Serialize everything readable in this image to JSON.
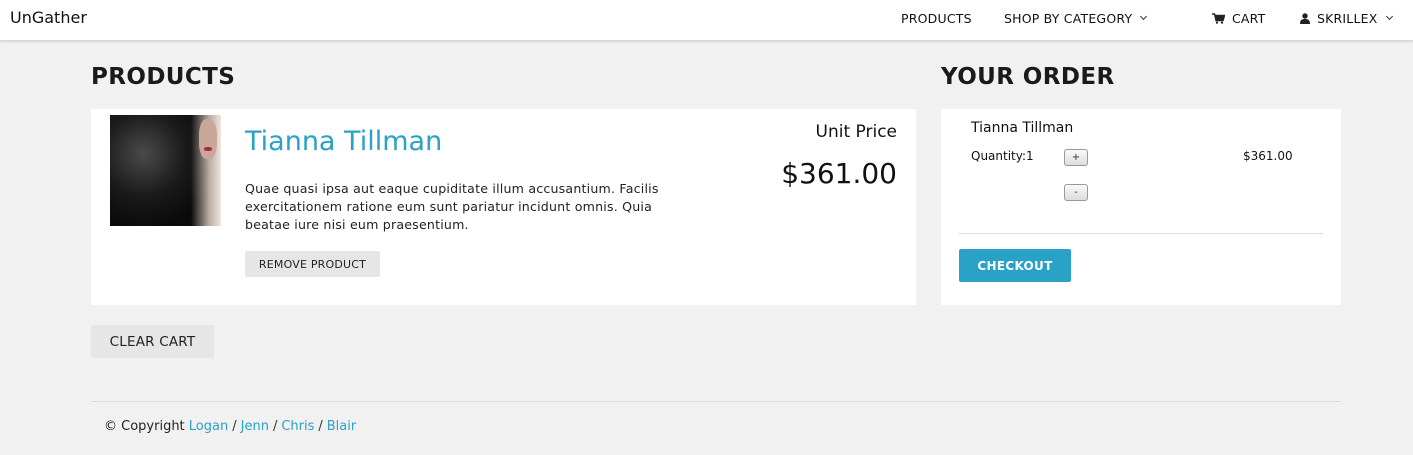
{
  "navbar": {
    "brand": "UnGather",
    "products": "PRODUCTS",
    "shop_by_category": "SHOP BY CATEGORY",
    "cart": "CART",
    "user": "SKRILLEX"
  },
  "products_section": {
    "title": "PRODUCTS",
    "item": {
      "name": "Tianna Tillman",
      "description": "Quae quasi ipsa aut eaque cupiditate illum accusantium. Facilis exercitationem ratione eum sunt pariatur incidunt omnis. Quia beatae iure nisi eum praesentium.",
      "remove_label": "REMOVE PRODUCT",
      "unit_price_label": "Unit Price",
      "unit_price": "$361.00"
    },
    "clear_cart_label": "CLEAR CART"
  },
  "order_section": {
    "title": "YOUR ORDER",
    "item_name": "Tianna Tillman",
    "quantity_label": "Quantity:1",
    "plus_label": "+",
    "minus_label": "-",
    "price": "$361.00",
    "checkout_label": "CHECKOUT"
  },
  "footer": {
    "copyright": "© Copyright",
    "authors": [
      "Logan",
      "Jenn",
      "Chris",
      "Blair"
    ]
  },
  "colors": {
    "accent": "#2aa1c6",
    "background": "#f1f1f1"
  },
  "icons": {
    "cart": "cart-icon",
    "user": "user-icon",
    "dropdown": "chevron-down-icon"
  }
}
